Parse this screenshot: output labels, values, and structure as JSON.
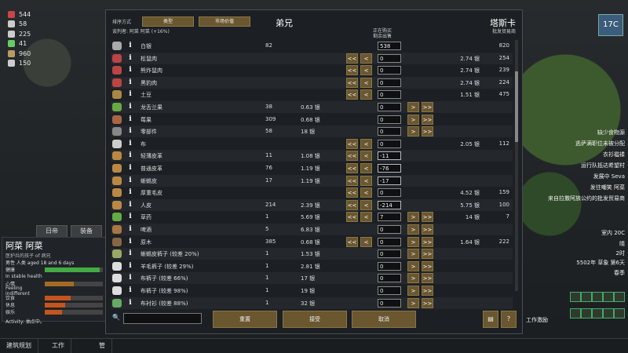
{
  "resources": [
    {
      "value": "544",
      "color": "#c44"
    },
    {
      "value": "58",
      "color": "#ccc"
    },
    {
      "value": "225",
      "color": "#ccc"
    },
    {
      "value": "41",
      "color": "#6c6"
    },
    {
      "value": "960",
      "color": "#b96"
    },
    {
      "value": "150",
      "color": "#ccc"
    }
  ],
  "left_buttons": {
    "schedule": "日帝",
    "gear": "装备"
  },
  "colonist": {
    "name": "阿菜 阿菜",
    "subtitle": "医护兵的孩子 of 病兄",
    "desc": "男性 人类 aged 18 and 6 days",
    "needs": [
      {
        "label": "健康",
        "fill": 0.95,
        "color": "#4a4"
      },
      {
        "label": "In stable health",
        "fill": 0,
        "color": "#4a4"
      },
      {
        "label": "心情",
        "fill": 0.5,
        "color": "#a66a22"
      },
      {
        "label": "Feeling indifferent",
        "fill": 0,
        "color": "#a66a22"
      },
      {
        "label": "饮食",
        "fill": 0.45,
        "color": "#c5551e"
      },
      {
        "label": "休息",
        "fill": 0.35,
        "color": "#c5551e"
      },
      {
        "label": "娱乐",
        "fill": 0.3,
        "color": "#c5551e"
      }
    ],
    "activity": "Activity: 抽点中。"
  },
  "bottom_tabs": [
    "建筑规划",
    "工作",
    "管"
  ],
  "right": {
    "temp": "17C",
    "alerts": [
      "缺少食物源",
      "逃萨满职位未被分配",
      "衣衫褴褛",
      "运行队抵达希望村",
      "发展中 Seva",
      "发往嘲笑 阿菜",
      "来自拉撒阿族公约的批发贸易商"
    ],
    "room": "室内 20C",
    "weather": "晴",
    "hour": "2时",
    "date": "5502年 草象 第6天",
    "season": "春季",
    "work_area": "工作激励"
  },
  "dialog": {
    "sort_label": "排序方式",
    "sort_btn1": "类型",
    "sort_btn2": "市场价值",
    "negotiator": "谈判者: 阿菜 阿菜 (+16%)",
    "colony_title": "弟兄",
    "trader_title": "塔斯卡",
    "trader_sub": "批发贸易商",
    "ghost_label1": "正在购买",
    "ghost_label2": "剩余出售",
    "rows": [
      {
        "name": "白银",
        "count": "82",
        "price": "",
        "qty": "538",
        "tprice": "",
        "tcount": "820",
        "icon": "#aaa",
        "buy": false,
        "sell": false,
        "neg": false
      },
      {
        "name": "松鼠肉",
        "count": "",
        "price": "",
        "qty": "0",
        "tprice": "2.74 银",
        "tcount": "254",
        "icon": "#b44",
        "buy": true,
        "sell": false,
        "neg": false
      },
      {
        "name": "熊炸鼠肉",
        "count": "",
        "price": "",
        "qty": "0",
        "tprice": "2.74 银",
        "tcount": "239",
        "icon": "#b44",
        "buy": true,
        "sell": false,
        "neg": false
      },
      {
        "name": "黑豹肉",
        "count": "",
        "price": "",
        "qty": "0",
        "tprice": "2.74 银",
        "tcount": "224",
        "icon": "#b44",
        "buy": true,
        "sell": false,
        "neg": false
      },
      {
        "name": "土豆",
        "count": "",
        "price": "",
        "qty": "0",
        "tprice": "1.51 银",
        "tcount": "475",
        "icon": "#a84",
        "buy": true,
        "sell": false,
        "neg": false
      },
      {
        "name": "龙舌兰果",
        "count": "38",
        "price": "0.63 银",
        "qty": "0",
        "tprice": "",
        "tcount": "",
        "icon": "#6a4",
        "buy": false,
        "sell": true,
        "neg": false
      },
      {
        "name": "莓果",
        "count": "309",
        "price": "0.68 银",
        "qty": "0",
        "tprice": "",
        "tcount": "",
        "icon": "#a64",
        "buy": false,
        "sell": true,
        "neg": false
      },
      {
        "name": "零部件",
        "count": "58",
        "price": "18 银",
        "qty": "0",
        "tprice": "",
        "tcount": "",
        "icon": "#888",
        "buy": false,
        "sell": true,
        "neg": false
      },
      {
        "name": "布",
        "count": "",
        "price": "",
        "qty": "0",
        "tprice": "2.05 银",
        "tcount": "112",
        "icon": "#ccc",
        "buy": true,
        "sell": false,
        "neg": false
      },
      {
        "name": "轻薄皮革",
        "count": "11",
        "price": "1.08 银",
        "qty": "-11",
        "tprice": "",
        "tcount": "",
        "icon": "#b84",
        "buy": false,
        "sell": false,
        "neg": true
      },
      {
        "name": "普通皮革",
        "count": "76",
        "price": "1.19 银",
        "qty": "-76",
        "tprice": "",
        "tcount": "",
        "icon": "#b84",
        "buy": false,
        "sell": false,
        "neg": true
      },
      {
        "name": "蜥蜴皮",
        "count": "17",
        "price": "1.19 银",
        "qty": "-17",
        "tprice": "",
        "tcount": "",
        "icon": "#b84",
        "buy": false,
        "sell": false,
        "neg": true
      },
      {
        "name": "厚重毛皮",
        "count": "",
        "price": "",
        "qty": "0",
        "tprice": "4.52 银",
        "tcount": "159",
        "icon": "#b84",
        "buy": true,
        "sell": false,
        "neg": false
      },
      {
        "name": "人皮",
        "count": "214",
        "price": "2.39 银",
        "qty": "-214",
        "tprice": "5.75 银",
        "tcount": "100",
        "icon": "#b84",
        "buy": true,
        "sell": false,
        "neg": true
      },
      {
        "name": "草药",
        "count": "1",
        "price": "5.69 银",
        "qty": "7",
        "tprice": "14 银",
        "tcount": "7",
        "icon": "#6a4",
        "buy": true,
        "sell": true,
        "neg": false
      },
      {
        "name": "啤酒",
        "count": "5",
        "price": "6.83 银",
        "qty": "0",
        "tprice": "",
        "tcount": "",
        "icon": "#a74",
        "buy": false,
        "sell": true,
        "neg": false
      },
      {
        "name": "原木",
        "count": "385",
        "price": "0.68 银",
        "qty": "0",
        "tprice": "1.64 银",
        "tcount": "222",
        "icon": "#864",
        "buy": true,
        "sell": true,
        "neg": false
      },
      {
        "name": "蜥蜴皮裤子 (较差 20%)",
        "count": "1",
        "price": "1.53 银",
        "qty": "0",
        "tprice": "",
        "tcount": "",
        "icon": "#9a6",
        "buy": false,
        "sell": true,
        "neg": false
      },
      {
        "name": "羊毛裤子 (较差 29%)",
        "count": "1",
        "price": "2.81 银",
        "qty": "0",
        "tprice": "",
        "tcount": "",
        "icon": "#ddd",
        "buy": false,
        "sell": true,
        "neg": false
      },
      {
        "name": "布裤子 (较差 66%)",
        "count": "1",
        "price": "17 银",
        "qty": "0",
        "tprice": "",
        "tcount": "",
        "icon": "#ddd",
        "buy": false,
        "sell": true,
        "neg": false
      },
      {
        "name": "布裤子 (较差 98%)",
        "count": "1",
        "price": "19 银",
        "qty": "0",
        "tprice": "",
        "tcount": "",
        "icon": "#ddd",
        "buy": false,
        "sell": true,
        "neg": false
      },
      {
        "name": "布衬衫 (较差 88%)",
        "count": "1",
        "price": "32 银",
        "qty": "0",
        "tprice": "",
        "tcount": "",
        "icon": "#6a6",
        "buy": false,
        "sell": true,
        "neg": false
      }
    ],
    "reset": "重置",
    "accept": "接受",
    "cancel": "取消"
  }
}
